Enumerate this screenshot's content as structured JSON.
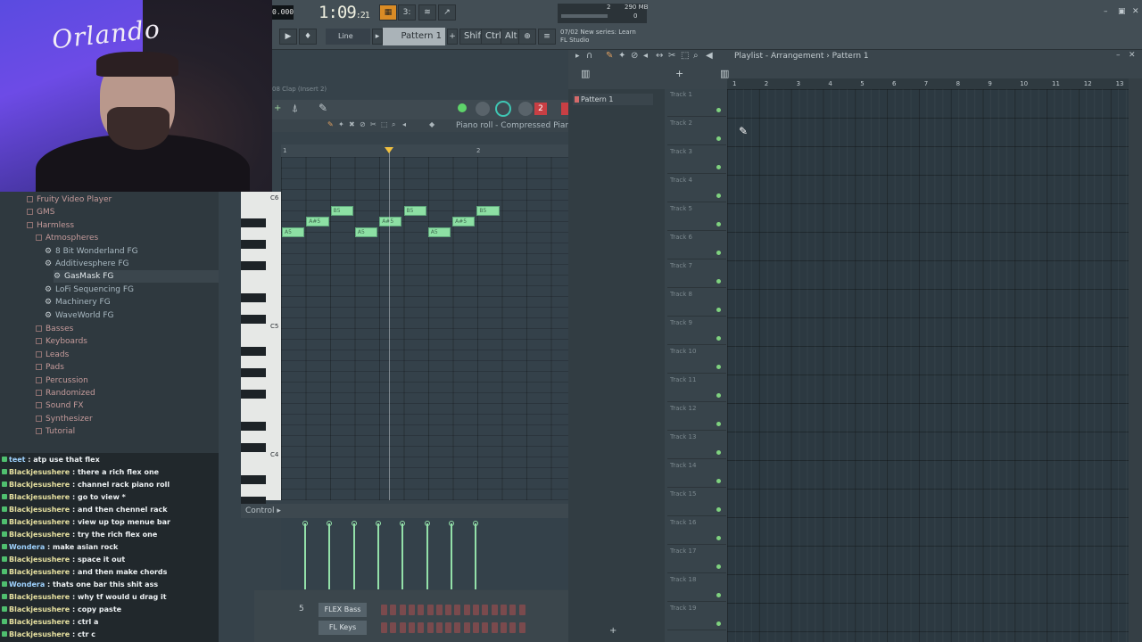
{
  "toolbar": {
    "tempo": "0.000",
    "time_main": "1:09",
    "time_sub": ":21",
    "cpu": "2",
    "memory": "290 MB",
    "voices": "0",
    "snap": "Line",
    "pattern": "Pattern 1",
    "mods": [
      "Shift",
      "Ctrl",
      "Alt"
    ],
    "news_line1": "07/02  New series: Learn",
    "news_line2": "FL Studio"
  },
  "webcam": {
    "signature": "Orlando"
  },
  "browser": {
    "items": [
      {
        "label": "Fruity Video Player",
        "type": "folder",
        "depth": 1
      },
      {
        "label": "GMS",
        "type": "folder",
        "depth": 1
      },
      {
        "label": "Harmless",
        "type": "folder",
        "depth": 1
      },
      {
        "label": "Atmospheres",
        "type": "folder",
        "depth": 2
      },
      {
        "label": "8 Bit Wonderland FG",
        "type": "preset",
        "depth": 3
      },
      {
        "label": "Additivesphere FG",
        "type": "preset",
        "depth": 3
      },
      {
        "label": "GasMask FG",
        "type": "preset",
        "depth": 4,
        "selected": true
      },
      {
        "label": "LoFi Sequencing FG",
        "type": "preset",
        "depth": 3
      },
      {
        "label": "Machinery FG",
        "type": "preset",
        "depth": 3
      },
      {
        "label": "WaveWorld FG",
        "type": "preset",
        "depth": 3
      },
      {
        "label": "Basses",
        "type": "folder",
        "depth": 2
      },
      {
        "label": "Keyboards",
        "type": "folder",
        "depth": 2
      },
      {
        "label": "Leads",
        "type": "folder",
        "depth": 2
      },
      {
        "label": "Pads",
        "type": "folder",
        "depth": 2
      },
      {
        "label": "Percussion",
        "type": "folder",
        "depth": 2
      },
      {
        "label": "Randomized",
        "type": "folder",
        "depth": 2
      },
      {
        "label": "Sound FX",
        "type": "folder",
        "depth": 2
      },
      {
        "label": "Synthesizer",
        "type": "folder",
        "depth": 2
      },
      {
        "label": "Tutorial",
        "type": "folder",
        "depth": 2
      }
    ]
  },
  "chat": [
    {
      "user": "teet",
      "msg": "atp use that flex"
    },
    {
      "user": "Blackjesushere",
      "msg": "there a rich flex one"
    },
    {
      "user": "Blackjesushere",
      "msg": "channel rack piano roll"
    },
    {
      "user": "Blackjesushere",
      "msg": "go to view *"
    },
    {
      "user": "Blackjesushere",
      "msg": "and then chennel rack"
    },
    {
      "user": "Blackjesushere",
      "msg": "view up top menue bar"
    },
    {
      "user": "Blackjesushere",
      "msg": "try the rich flex one"
    },
    {
      "user": "Wondera",
      "msg": "make asian rock"
    },
    {
      "user": "Blackjesushere",
      "msg": "space it out"
    },
    {
      "user": "Blackjesushere",
      "msg": "and then make chords"
    },
    {
      "user": "Wondera",
      "msg": "thats one bar this shit ass"
    },
    {
      "user": "Blackjesushere",
      "msg": "why tf would u drag it"
    },
    {
      "user": "Blackjesushere",
      "msg": "copy paste"
    },
    {
      "user": "Blackjesushere",
      "msg": "ctrl a"
    },
    {
      "user": "Blackjesushere",
      "msg": "ctr c"
    }
  ],
  "piano_roll": {
    "channel": "08 Clap (Insert 2)",
    "title": "Piano roll - Compressed Piano",
    "ruler": [
      "1",
      "2"
    ],
    "octaves": [
      "C6",
      "C5",
      "C4"
    ],
    "notes": [
      {
        "label": "A5",
        "start": 0,
        "len": 1,
        "row": 2
      },
      {
        "label": "A#5",
        "start": 1,
        "len": 1,
        "row": 1
      },
      {
        "label": "B5",
        "start": 2,
        "len": 1,
        "row": 0
      },
      {
        "label": "A5",
        "start": 3,
        "len": 1,
        "row": 2
      },
      {
        "label": "A#5",
        "start": 4,
        "len": 1,
        "row": 1
      },
      {
        "label": "B5",
        "start": 5,
        "len": 1,
        "row": 0
      },
      {
        "label": "A5",
        "start": 6,
        "len": 1,
        "row": 2
      },
      {
        "label": "A#5",
        "start": 7,
        "len": 1,
        "row": 1
      },
      {
        "label": "B5",
        "start": 8,
        "len": 1,
        "row": 0
      }
    ],
    "control_label": "Control",
    "velocities": [
      1,
      1,
      1,
      1,
      1,
      1,
      1,
      1
    ]
  },
  "channel_rack": {
    "rows": [
      {
        "num": "5",
        "name": "FLEX Bass"
      },
      {
        "num": "",
        "name": "FL Keys"
      }
    ]
  },
  "playlist": {
    "title": "Playlist - Arrangement › Pattern 1",
    "pattern_item": "Pattern 1",
    "ruler": [
      "1",
      "2",
      "3",
      "4",
      "5",
      "6",
      "7",
      "8",
      "9",
      "10",
      "11",
      "12",
      "13"
    ],
    "tracks": [
      "Track 1",
      "Track 2",
      "Track 3",
      "Track 4",
      "Track 5",
      "Track 6",
      "Track 7",
      "Track 8",
      "Track 9",
      "Track 10",
      "Track 11",
      "Track 12",
      "Track 13",
      "Track 14",
      "Track 15",
      "Track 16",
      "Track 17",
      "Track 18",
      "Track 19"
    ]
  },
  "icons": {
    "play": "play-icon",
    "stop": "stop-icon",
    "record": "record-icon",
    "close": "close-icon",
    "minimize": "minimize-icon",
    "maximize": "maximize-icon"
  }
}
